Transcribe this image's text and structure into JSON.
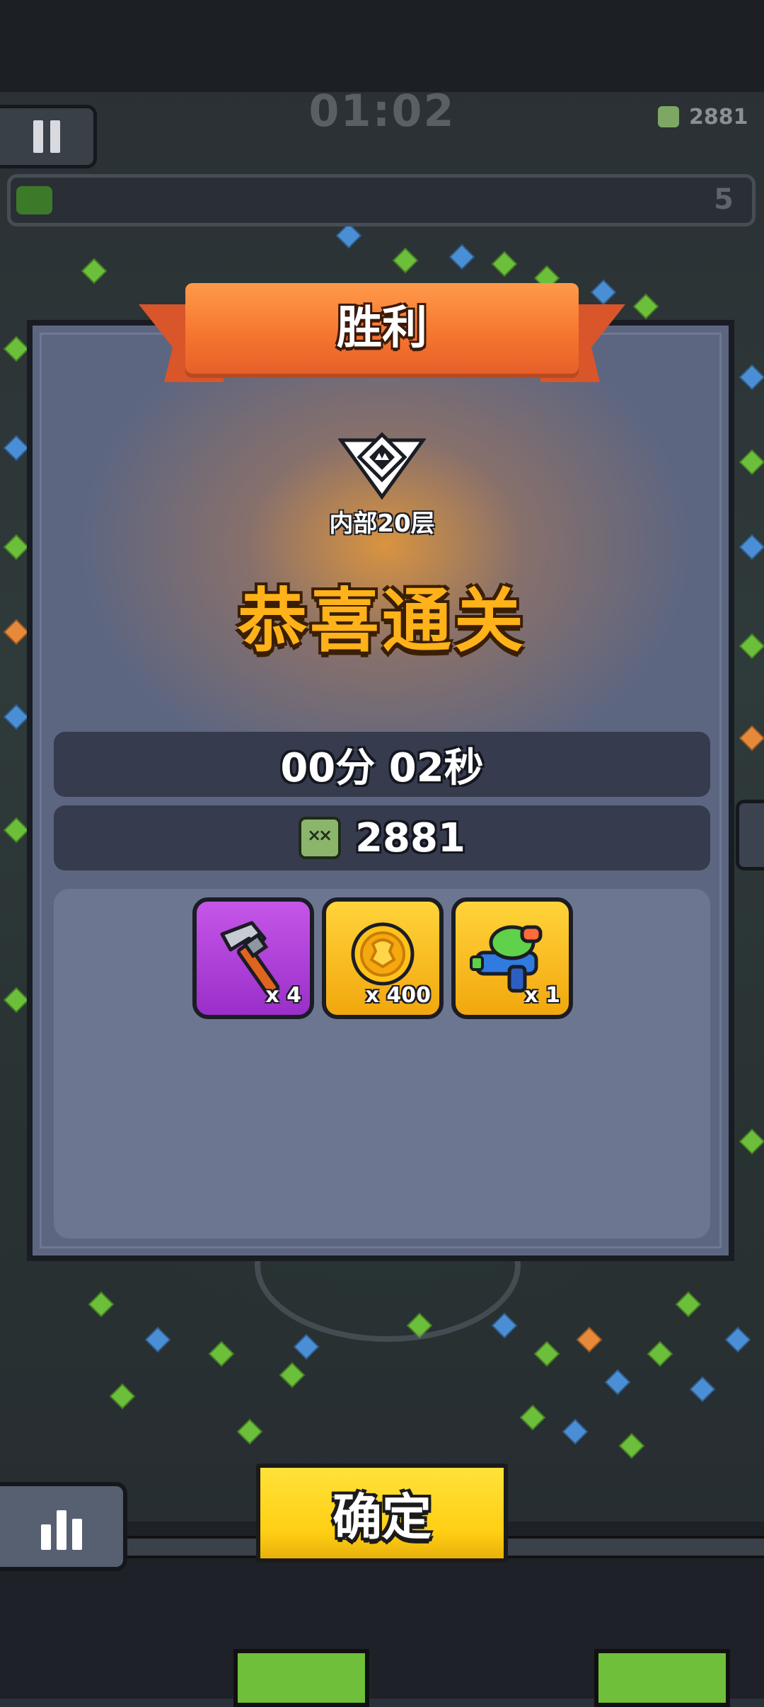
{
  "hud": {
    "timer": "01:02",
    "top_kill_count": "2881",
    "level_number": "5",
    "progress_fraction": 0.05
  },
  "result": {
    "title": "胜利",
    "floor_name": "内部20层",
    "headline": "恭喜通关",
    "time_text": "00分 02秒",
    "kill_count": "2881"
  },
  "rewards": [
    {
      "icon": "hammer-icon",
      "quantity_label": "x 4",
      "rarity_color": "#b844e0"
    },
    {
      "icon": "gold-coin-icon",
      "quantity_label": "x 400",
      "rarity_color": "#f7b917"
    },
    {
      "icon": "water-gun-icon",
      "quantity_label": "x 1",
      "rarity_color": "#f7b917"
    }
  ],
  "buttons": {
    "confirm_label": "确定"
  },
  "icons": {
    "pause": "pause-icon",
    "stats": "bar-chart-icon",
    "rank": "rank-emblem-icon",
    "kills": "zombie-head-icon"
  },
  "colors": {
    "panel": "#5d6681",
    "ribbon": "#f5742e",
    "headline": "#ffb21a",
    "confirm": "#ffd21e"
  }
}
